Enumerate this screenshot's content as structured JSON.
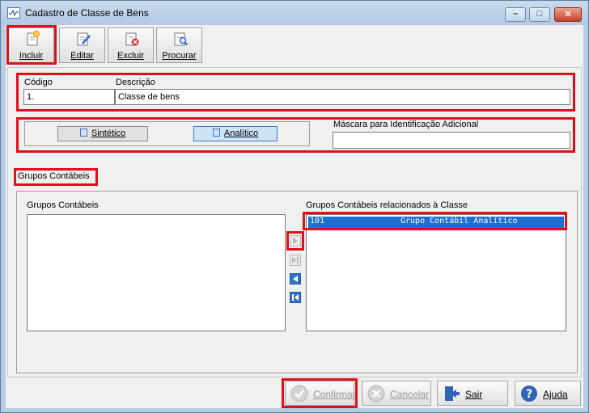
{
  "window": {
    "title": "Cadastro de Classe de Bens",
    "min_glyph": "–",
    "max_glyph": "□",
    "close_glyph": "✕"
  },
  "toolbar": {
    "incluir": "Incluir",
    "editar": "Editar",
    "excluir": "Excluir",
    "procurar": "Procurar"
  },
  "fields": {
    "codigo_label": "Código",
    "descricao_label": "Descrição",
    "codigo_value": "1.",
    "descricao_value": "Classe de bens",
    "mascara_label": "Máscara para Identificação Adicional",
    "mascara_value": ""
  },
  "tipo": {
    "sintetico": "Sintético",
    "analitico": "Analítico",
    "selected": "Analítico"
  },
  "section_tab": "Grupos Contábeis",
  "lists": {
    "left_title": "Grupos Contábeis",
    "right_title": "Grupos Contábeis relacionados à Classe",
    "right_items": [
      {
        "code": "101",
        "name": "Grupo Contábil Analítico"
      }
    ]
  },
  "bottom": {
    "confirmar": "Confirmar",
    "cancelar": "Cancelar",
    "sair": "Sair",
    "ajuda": "Ajuda"
  },
  "colors": {
    "selection": "#1a6fd4",
    "highlight": "#e0101a",
    "titlebar": "#b7cde6"
  }
}
